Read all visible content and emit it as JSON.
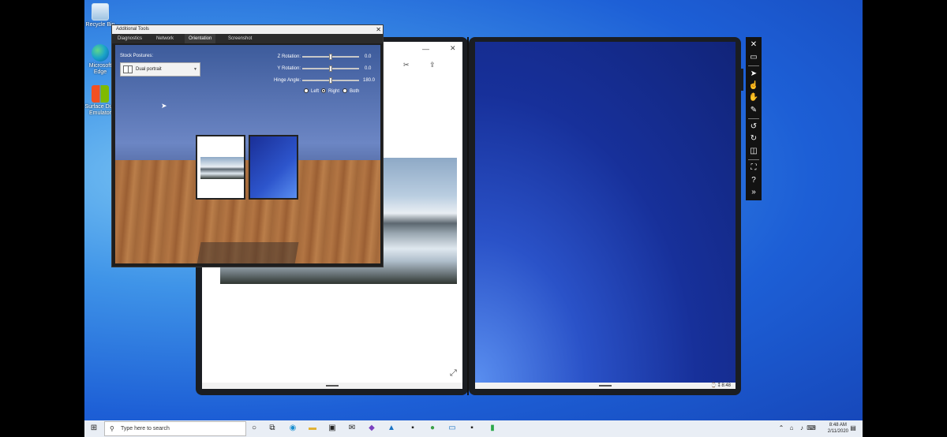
{
  "desktop": {
    "icons": [
      {
        "label": "Recycle Bin",
        "icon": "recycle-bin-icon"
      },
      {
        "label": "Microsoft Edge",
        "icon": "edge-icon"
      },
      {
        "label": "Surface Duo Emulator",
        "icon": "surface-duo-icon"
      }
    ]
  },
  "tools": {
    "title": "Additional Tools",
    "close": "✕",
    "tabs": [
      "Diagnostics",
      "Network",
      "Orientation",
      "Screenshot"
    ],
    "active_tab": "Orientation",
    "stock_postures_label": "Stock Postures:",
    "posture_value": "Dual portrait",
    "z_rotation_label": "Z Rotation:",
    "z_rotation_value": "0.0",
    "y_rotation_label": "Y Rotation:",
    "y_rotation_value": "0.0",
    "hinge_angle_label": "Hinge Angle:",
    "hinge_angle_value": "180.0",
    "radios": [
      {
        "label": "Left",
        "checked": false
      },
      {
        "label": "Right",
        "checked": true
      },
      {
        "label": "Both",
        "checked": false
      }
    ]
  },
  "device": {
    "right_status": "⌚ ⁑  8:48"
  },
  "emulator_toolbar": [
    {
      "icon": "close-icon",
      "glyph": "✕"
    },
    {
      "icon": "minimize-icon",
      "glyph": "▭"
    },
    {
      "icon": "pointer-icon",
      "glyph": "➤"
    },
    {
      "icon": "touch-icon",
      "glyph": "☝"
    },
    {
      "icon": "multi-touch-icon",
      "glyph": "✋"
    },
    {
      "icon": "pen-icon",
      "glyph": "✎"
    },
    {
      "icon": "rotate-left-icon",
      "glyph": "↺"
    },
    {
      "icon": "rotate-right-icon",
      "glyph": "↻"
    },
    {
      "icon": "dual-screen-icon",
      "glyph": "◫"
    },
    {
      "icon": "fit-to-screen-icon",
      "glyph": "⛶"
    },
    {
      "icon": "help-icon",
      "glyph": "?"
    },
    {
      "icon": "more-tools-icon",
      "glyph": "»"
    }
  ],
  "taskbar": {
    "search_placeholder": "Type here to search",
    "time": "8:48 AM",
    "date": "2/11/2020"
  }
}
